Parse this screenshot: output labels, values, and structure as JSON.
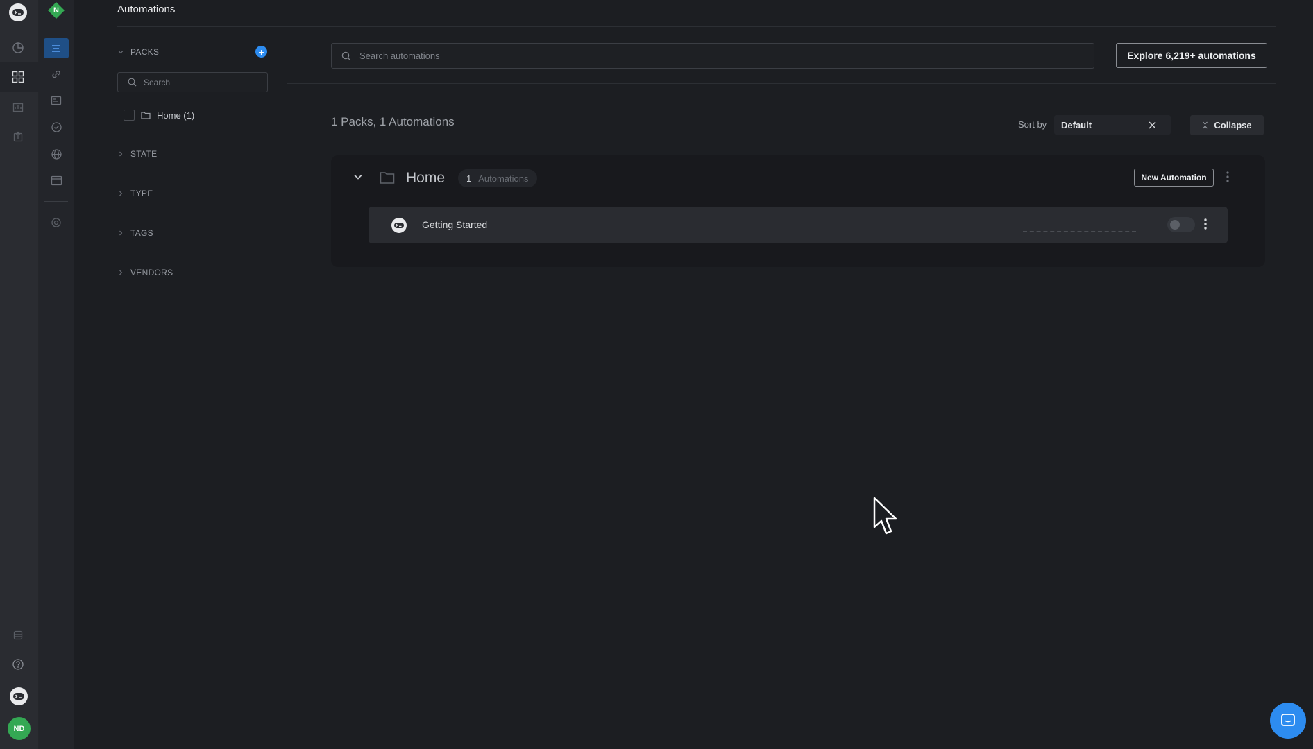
{
  "header": {
    "title": "Automations"
  },
  "workspace": {
    "initial": "N",
    "color": "#34a853"
  },
  "user": {
    "initials": "ND",
    "color": "#34a853"
  },
  "sidebar": {
    "sections": [
      {
        "label": "PACKS",
        "expanded": true
      },
      {
        "label": "STATE",
        "expanded": false
      },
      {
        "label": "TYPE",
        "expanded": false
      },
      {
        "label": "TAGS",
        "expanded": false
      },
      {
        "label": "VENDORS",
        "expanded": false
      }
    ],
    "search_placeholder": "Search",
    "packs": [
      {
        "label": "Home (1)",
        "checked": false
      }
    ]
  },
  "main": {
    "search_placeholder": "Search automations",
    "explore_label": "Explore 6,219+ automations",
    "summary": "1 Packs, 1 Automations",
    "sort": {
      "label": "Sort by",
      "value": "Default"
    },
    "collapse_label": "Collapse",
    "pack": {
      "name": "Home",
      "count": "1",
      "count_label": "Automations",
      "new_button": "New Automation",
      "automations": [
        {
          "name": "Getting Started",
          "enabled": false
        }
      ]
    }
  },
  "colors": {
    "accent": "#2d8cf0",
    "background": "#1c1e22",
    "success": "#34a853"
  },
  "icons": {
    "rail1": [
      "app-logo-icon",
      "dashboard-icon",
      "automations-icon",
      "reports-icon",
      "export-icon",
      "storage-icon",
      "help-icon",
      "assistant-icon"
    ],
    "rail2": [
      "list-icon",
      "link-icon",
      "id-icon",
      "check-badge-icon",
      "globe-icon",
      "window-icon",
      "target-icon"
    ]
  }
}
